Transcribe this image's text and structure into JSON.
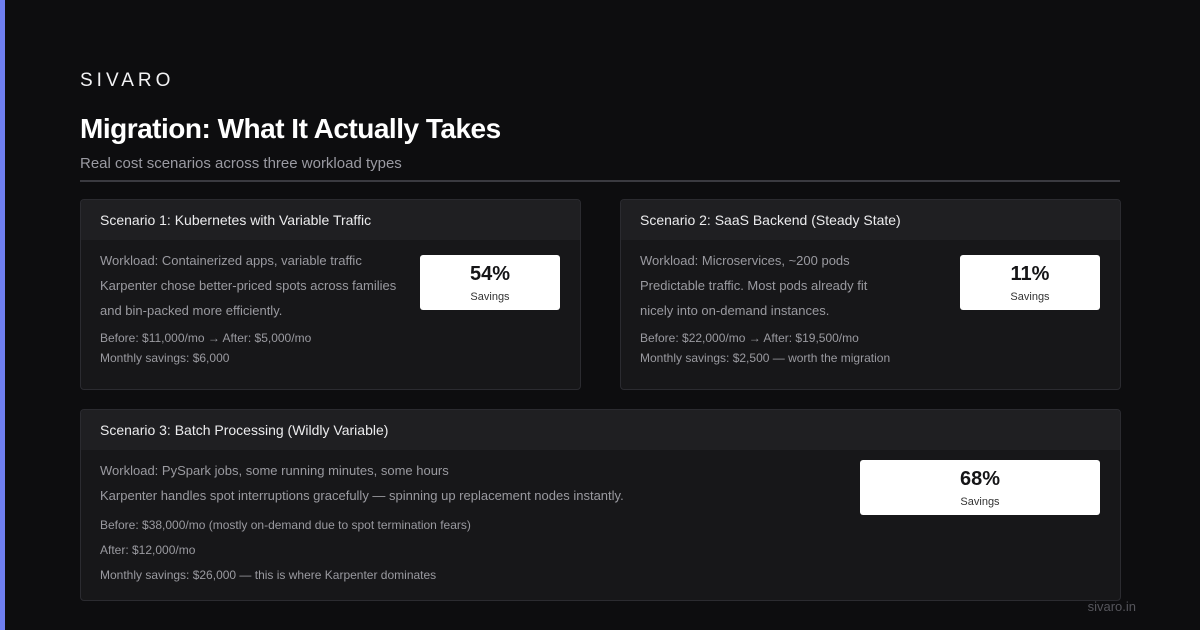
{
  "brand": "SIVARO",
  "title": "Migration: What It Actually Takes",
  "subtitle": "Real cost scenarios across three workload types",
  "colors": {
    "accent": "#6f7ff0",
    "background": "#0d0d0f",
    "card": "#171719",
    "card_header": "#1f1f22"
  },
  "scenarios": [
    {
      "header": "Scenario 1: Kubernetes with Variable Traffic",
      "lines": [
        "Workload: Containerized apps, variable traffic",
        "Karpenter chose better-priced spots across families",
        "and bin-packed more efficiently."
      ],
      "details": [
        "Before: $11,000/mo → After: $5,000/mo",
        "Monthly savings: $6,000"
      ],
      "metric_value": "54%",
      "metric_label": "Savings"
    },
    {
      "header": "Scenario 2: SaaS Backend (Steady State)",
      "lines": [
        "Workload: Microservices, ~200 pods",
        "Predictable traffic. Most pods already fit",
        "nicely into on-demand instances."
      ],
      "details": [
        "Before: $22,000/mo → After: $19,500/mo",
        "Monthly savings: $2,500 — worth the migration"
      ],
      "metric_value": "11%",
      "metric_label": "Savings"
    },
    {
      "header": "Scenario 3: Batch Processing (Wildly Variable)",
      "lines": [
        "Workload: PySpark jobs, some running minutes, some hours",
        "Karpenter handles spot interruptions gracefully — spinning up replacement nodes instantly."
      ],
      "details": [
        "Before: $38,000/mo (mostly on-demand due to spot termination fears)",
        "After: $12,000/mo",
        "Monthly savings: $26,000 — this is where Karpenter dominates"
      ],
      "metric_value": "68%",
      "metric_label": "Savings"
    }
  ],
  "footer": "sivaro.in"
}
